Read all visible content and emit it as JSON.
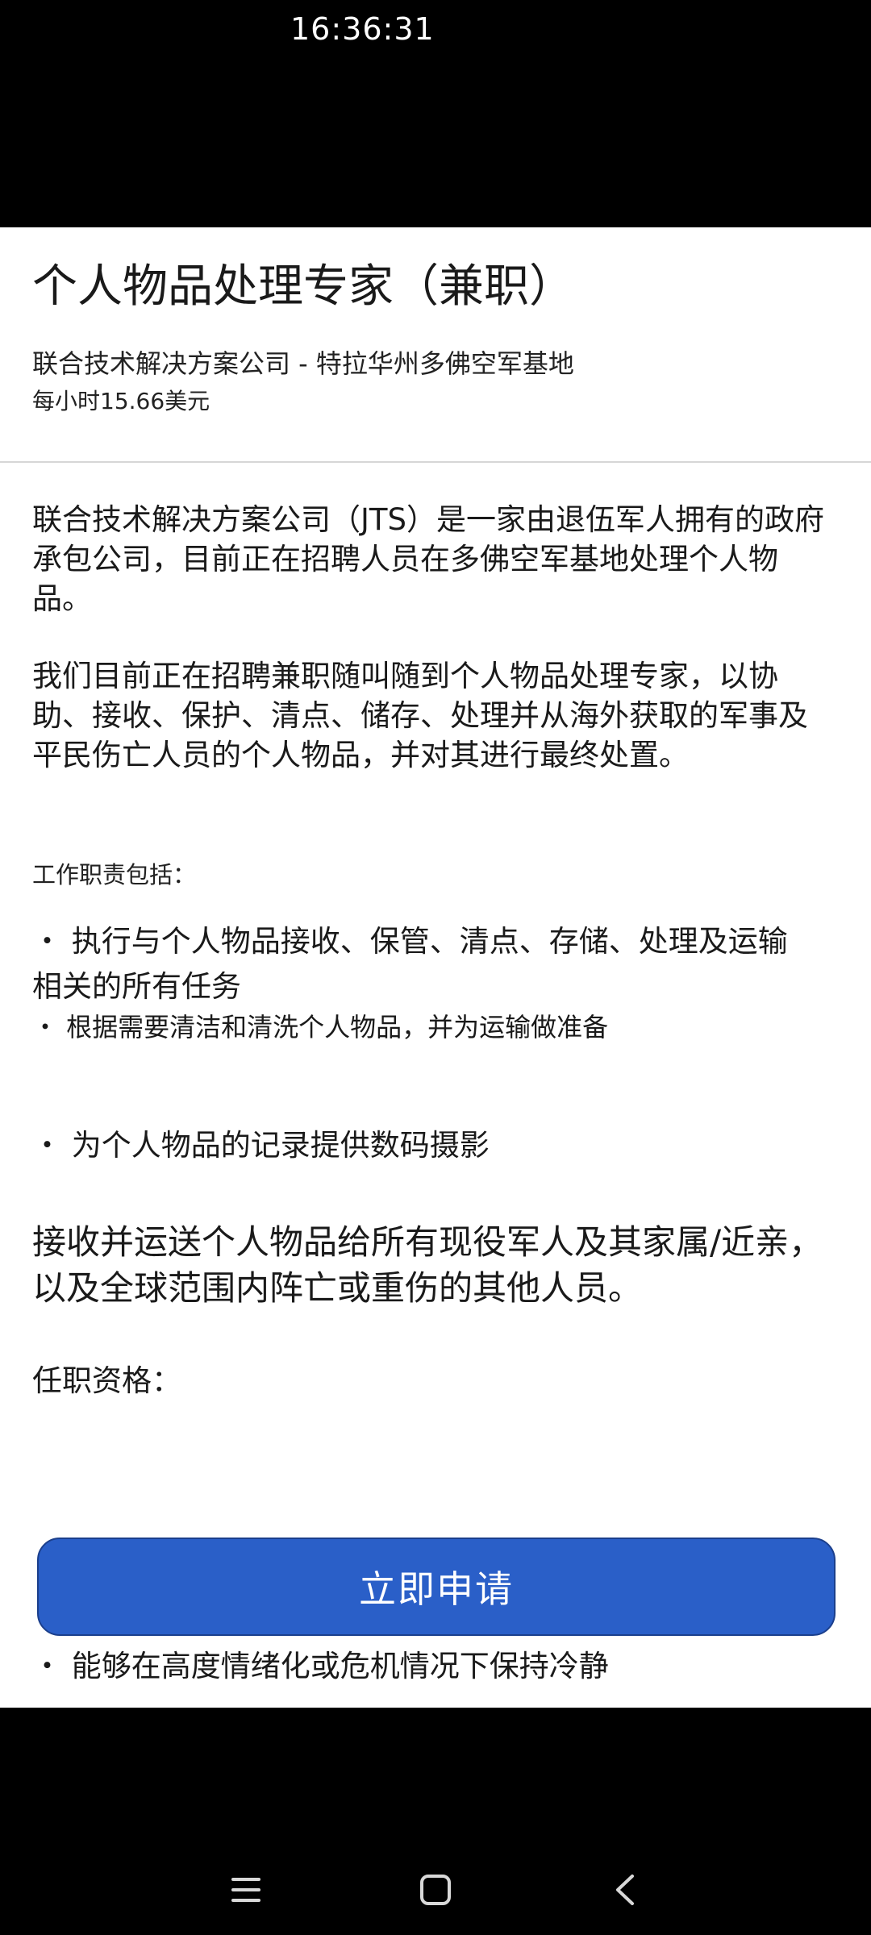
{
  "status_bar": {
    "time": "16:36:31"
  },
  "header": {
    "title": "个人物品处理专家（兼职）",
    "company_location": "联合技术解决方案公司 - 特拉华州多佛空军基地",
    "pay": "每小时15.66美元"
  },
  "body": {
    "paragraph_1": "联合技术解决方案公司（JTS）是一家由退伍军人拥有的政府承包公司，目前正在招聘人员在多佛空军基地处理个人物品。",
    "paragraph_2": "我们目前正在招聘兼职随叫随到个人物品处理专家，以协助、接收、保护、清点、储存、处理并从海外获取的军事及平民伤亡人员的个人物品，并对其进行最终处置。",
    "duties_heading": "工作职责包括：",
    "duties": [
      "・ 执行与个人物品接收、保管、清点、存储、处理及运输相关的所有任务",
      "・ 根据需要清洁和清洗个人物品，并为运输做准备",
      "・ 为个人物品的记录提供数码摄影"
    ],
    "paragraph_3": "接收并运送个人物品给所有现役军人及其家属/近亲，以及全球范围内阵亡或重伤的其他人员。",
    "qualifications_heading": "任职资格：",
    "qualifications": [
      "・ 能够在高度情绪化或危机情况下保持冷静"
    ]
  },
  "apply_button": {
    "label": "立即申请",
    "color": "#2a5fc8"
  },
  "nav_bar": {
    "icons": [
      "menu-icon",
      "home-icon",
      "back-icon"
    ]
  }
}
